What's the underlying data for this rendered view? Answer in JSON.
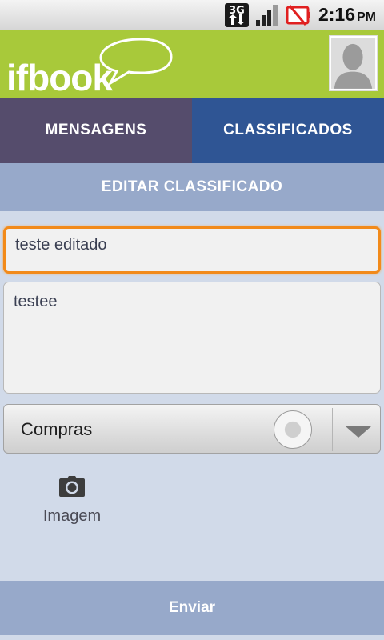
{
  "status_bar": {
    "network": "3G",
    "time": "2:16",
    "ampm": "PM",
    "icons": [
      "3g-data-icon",
      "signal-icon",
      "battery-alert-icon"
    ]
  },
  "header": {
    "logo_text": "ifbook",
    "avatar": "default-user-avatar"
  },
  "tabs": [
    {
      "label": "MENSAGENS",
      "color": "#554c6c"
    },
    {
      "label": "CLASSIFICADOS",
      "color": "#2f5594"
    }
  ],
  "section": {
    "title": "EDITAR CLASSIFICADO"
  },
  "form": {
    "title_value": "teste editado",
    "description_value": "testee",
    "category_selected": "Compras",
    "image_label": "Imagem",
    "image_icon": "camera-icon",
    "submit_label": "Enviar"
  },
  "colors": {
    "header_green": "#a8c93a",
    "focus_orange": "#f28a1a",
    "bar_blue": "#97a9ca",
    "background": "#d1dae9"
  }
}
